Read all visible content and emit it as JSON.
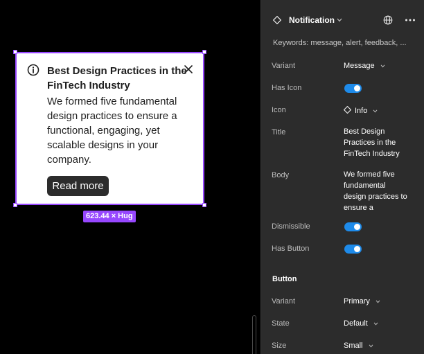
{
  "canvas": {
    "card": {
      "title": "Best Design Practices in the FinTech Industry",
      "body": "We formed five fundamental design practices to ensure a functional, engaging, yet scalable designs in your company.",
      "button_label": "Read more",
      "icon": "info-icon",
      "close_icon": "close-icon"
    },
    "size_badge": "623.44 × Hug",
    "accent_color": "#9747ff"
  },
  "panel": {
    "component_name": "Notification",
    "keywords": "Keywords: message, alert, feedback, ...",
    "properties": [
      {
        "label": "Variant",
        "value": "Message"
      },
      {
        "label": "Has Icon",
        "value": "on"
      },
      {
        "label": "Icon",
        "value": "Info"
      },
      {
        "label": "Title",
        "value": "Best Design Practices in the FinTech Industry"
      },
      {
        "label": "Body",
        "value": "We formed five fundamental design practices to ensure a"
      },
      {
        "label": "Dismissible",
        "value": "on"
      },
      {
        "label": "Has Button",
        "value": "on"
      }
    ],
    "button_section": {
      "title": "Button",
      "properties": [
        {
          "label": "Variant",
          "value": "Primary"
        },
        {
          "label": "State",
          "value": "Default"
        },
        {
          "label": "Size",
          "value": "Small"
        }
      ]
    },
    "toggle_color": "#1e8bea"
  }
}
